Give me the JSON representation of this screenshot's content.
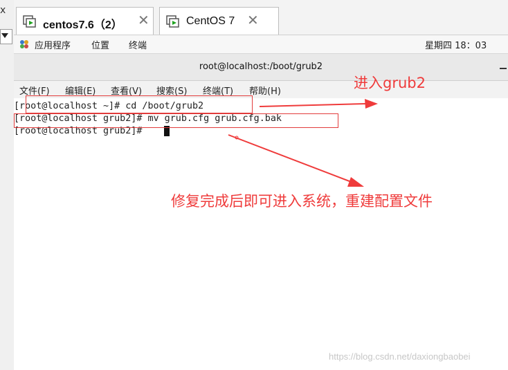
{
  "tabs": [
    {
      "label": "centos7.6（2）",
      "active": true
    },
    {
      "label": "CentOS 7",
      "active": false
    }
  ],
  "left_strip": {
    "close_glyph": "x"
  },
  "topbar": {
    "applications": "应用程序",
    "places": "位置",
    "terminal": "终端",
    "clock": "星期四 18：03"
  },
  "window": {
    "title": "root@localhost:/boot/grub2"
  },
  "menu": {
    "file": "文件(F)",
    "edit": "编辑(E)",
    "view": "查看(V)",
    "search": "搜索(S)",
    "terminal": "终端(T)",
    "help": "帮助(H)"
  },
  "terminal": {
    "lines": [
      "[root@localhost ~]# cd /boot/grub2",
      "[root@localhost grub2]# mv grub.cfg grub.cfg.bak",
      "[root@localhost grub2]# "
    ]
  },
  "annotations": {
    "enter_grub2": "进入grub2",
    "after_repair": "修复完成后即可进入系统，重建配置文件",
    "color": "#ef3b3b"
  },
  "watermark": "https://blog.csdn.net/daxiongbaobei"
}
